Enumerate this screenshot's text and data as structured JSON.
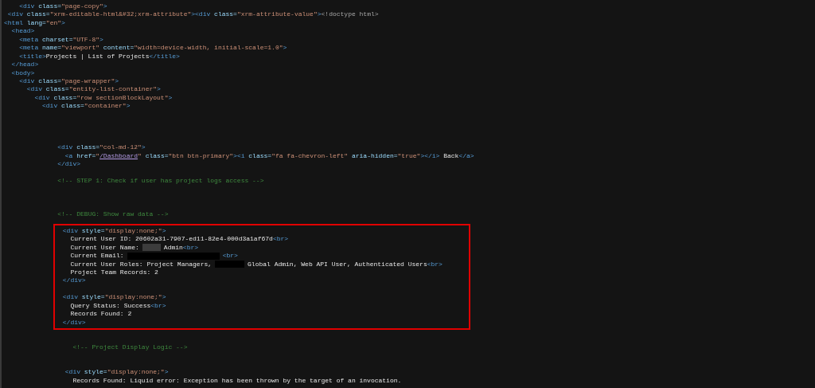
{
  "lines": [
    {
      "kind": "code",
      "tokens": [
        {
          "kind": "tag",
          "text": "    <div"
        },
        {
          "kind": "attr",
          "text": " class="
        },
        {
          "kind": "value",
          "text": "\"page-copy\""
        },
        {
          "kind": "tag",
          "text": ">"
        }
      ]
    },
    {
      "kind": "code",
      "tokens": [
        {
          "kind": "tag",
          "text": " <div"
        },
        {
          "kind": "attr",
          "text": " class="
        },
        {
          "kind": "value",
          "text": "\"xrm-editable-html&#32;xrm-attribute\""
        },
        {
          "kind": "tag",
          "text": "><div"
        },
        {
          "kind": "attr",
          "text": " class="
        },
        {
          "kind": "value",
          "text": "\"xrm-attribute-value\""
        },
        {
          "kind": "tag",
          "text": ">"
        },
        {
          "kind": "doctype",
          "text": "<!doctype html>"
        }
      ]
    },
    {
      "kind": "code",
      "tokens": [
        {
          "kind": "tag",
          "text": "<html"
        },
        {
          "kind": "attr",
          "text": " lang="
        },
        {
          "kind": "value",
          "text": "\"en\""
        },
        {
          "kind": "tag",
          "text": ">"
        }
      ]
    },
    {
      "kind": "code",
      "tokens": [
        {
          "kind": "tag",
          "text": "  <head>"
        }
      ]
    },
    {
      "kind": "code",
      "tokens": [
        {
          "kind": "tag",
          "text": "    <meta"
        },
        {
          "kind": "attr",
          "text": " charset="
        },
        {
          "kind": "value",
          "text": "\"UTF-8\""
        },
        {
          "kind": "tag",
          "text": ">"
        }
      ]
    },
    {
      "kind": "code",
      "tokens": [
        {
          "kind": "tag",
          "text": "    <meta"
        },
        {
          "kind": "attr",
          "text": " name="
        },
        {
          "kind": "value",
          "text": "\"viewport\""
        },
        {
          "kind": "attr",
          "text": " content="
        },
        {
          "kind": "value",
          "text": "\"width=device-width, initial-scale=1.0\""
        },
        {
          "kind": "tag",
          "text": ">"
        }
      ]
    },
    {
      "kind": "code",
      "tokens": [
        {
          "kind": "tag",
          "text": "    <title>"
        },
        {
          "kind": "text",
          "text": "Projects | List of Projects"
        },
        {
          "kind": "tag",
          "text": "</title>"
        }
      ]
    },
    {
      "kind": "code",
      "tokens": [
        {
          "kind": "tag",
          "text": "  </head>"
        }
      ]
    },
    {
      "kind": "code",
      "tokens": [
        {
          "kind": "tag",
          "text": "  <body>"
        }
      ]
    },
    {
      "kind": "code",
      "tokens": [
        {
          "kind": "tag",
          "text": "    <div"
        },
        {
          "kind": "attr",
          "text": " class="
        },
        {
          "kind": "value",
          "text": "\"page-wrapper\""
        },
        {
          "kind": "tag",
          "text": ">"
        }
      ]
    },
    {
      "kind": "code",
      "tokens": [
        {
          "kind": "tag",
          "text": "      <div"
        },
        {
          "kind": "attr",
          "text": " class="
        },
        {
          "kind": "value",
          "text": "\"entity-list-container\""
        },
        {
          "kind": "tag",
          "text": ">"
        }
      ]
    },
    {
      "kind": "code",
      "tokens": [
        {
          "kind": "tag",
          "text": "        <div"
        },
        {
          "kind": "attr",
          "text": " class="
        },
        {
          "kind": "value",
          "text": "\"row sectionBlockLayout\""
        },
        {
          "kind": "tag",
          "text": ">"
        }
      ]
    },
    {
      "kind": "code",
      "tokens": [
        {
          "kind": "tag",
          "text": "          <div"
        },
        {
          "kind": "attr",
          "text": " class="
        },
        {
          "kind": "value",
          "text": "\"container\""
        },
        {
          "kind": "tag",
          "text": ">"
        }
      ]
    },
    {
      "kind": "blank"
    },
    {
      "kind": "blank"
    },
    {
      "kind": "blank"
    },
    {
      "kind": "blank"
    },
    {
      "kind": "code",
      "tokens": [
        {
          "kind": "tag",
          "text": "              <div"
        },
        {
          "kind": "attr",
          "text": " class="
        },
        {
          "kind": "value",
          "text": "\"col-md-12\""
        },
        {
          "kind": "tag",
          "text": ">"
        }
      ]
    },
    {
      "kind": "code",
      "tokens": [
        {
          "kind": "tag",
          "text": "                <a"
        },
        {
          "kind": "attr",
          "text": " href="
        },
        {
          "kind": "value",
          "text": "\""
        },
        {
          "kind": "link",
          "text": "/Dashboard"
        },
        {
          "kind": "value",
          "text": "\""
        },
        {
          "kind": "attr",
          "text": " class="
        },
        {
          "kind": "value",
          "text": "\"btn btn-primary\""
        },
        {
          "kind": "tag",
          "text": "><i"
        },
        {
          "kind": "attr",
          "text": " class="
        },
        {
          "kind": "value",
          "text": "\"fa fa-chevron-left\""
        },
        {
          "kind": "attr",
          "text": " aria-hidden="
        },
        {
          "kind": "value",
          "text": "\"true\""
        },
        {
          "kind": "tag",
          "text": "></i>"
        },
        {
          "kind": "text",
          "text": " Back"
        },
        {
          "kind": "tag",
          "text": "</a>"
        }
      ]
    },
    {
      "kind": "code",
      "tokens": [
        {
          "kind": "tag",
          "text": "              </div>"
        }
      ]
    },
    {
      "kind": "blank"
    },
    {
      "kind": "code",
      "tokens": [
        {
          "kind": "comment",
          "text": "              <!-- STEP 1: Check if user has project logs access -->"
        }
      ]
    },
    {
      "kind": "blank"
    },
    {
      "kind": "blank"
    },
    {
      "kind": "blank"
    },
    {
      "kind": "code",
      "tokens": [
        {
          "kind": "comment",
          "text": "              <!-- DEBUG: Show raw data -->"
        }
      ]
    },
    {
      "kind": "blank"
    },
    {
      "kind": "code",
      "highlighted": true,
      "tokens": [
        {
          "kind": "tag",
          "text": "                <div"
        },
        {
          "kind": "attr",
          "text": " style="
        },
        {
          "kind": "value",
          "text": "\"display:none;\""
        },
        {
          "kind": "tag",
          "text": ">"
        }
      ]
    },
    {
      "kind": "code",
      "highlighted": true,
      "tokens": [
        {
          "kind": "text",
          "text": "                  Current User ID: 20602a31-7907-ed11-82e4-000d3a1af67d"
        },
        {
          "kind": "tag",
          "text": "<br>"
        }
      ]
    },
    {
      "kind": "code",
      "highlighted": true,
      "tokens": [
        {
          "kind": "text",
          "text": "                  Current User Name:"
        },
        {
          "kind": "smudge"
        },
        {
          "kind": "text",
          "text": "Admin"
        },
        {
          "kind": "tag",
          "text": "<br>"
        }
      ]
    },
    {
      "kind": "code",
      "highlighted": true,
      "tokens": [
        {
          "kind": "text",
          "text": "                  Current Email:"
        },
        {
          "kind": "bar"
        },
        {
          "kind": "tag",
          "text": "<br>"
        }
      ]
    },
    {
      "kind": "code",
      "highlighted": true,
      "tokens": [
        {
          "kind": "text",
          "text": "                  Current User Roles: Project Managers,"
        },
        {
          "kind": "mask"
        },
        {
          "kind": "text",
          "text": "Global Admin, Web API User, Authenticated Users"
        },
        {
          "kind": "tag",
          "text": "<br>"
        }
      ]
    },
    {
      "kind": "code",
      "highlighted": true,
      "tokens": [
        {
          "kind": "text",
          "text": "                  Project Team Records: 2"
        }
      ]
    },
    {
      "kind": "code",
      "highlighted": true,
      "tokens": [
        {
          "kind": "tag",
          "text": "                </div>"
        }
      ]
    },
    {
      "kind": "blank",
      "highlighted": true
    },
    {
      "kind": "code",
      "highlighted": true,
      "tokens": [
        {
          "kind": "tag",
          "text": "                <div"
        },
        {
          "kind": "attr",
          "text": " style="
        },
        {
          "kind": "value",
          "text": "\"display:none;\""
        },
        {
          "kind": "tag",
          "text": ">"
        }
      ]
    },
    {
      "kind": "code",
      "highlighted": true,
      "tokens": [
        {
          "kind": "text",
          "text": "                  Query Status: Success"
        },
        {
          "kind": "tag",
          "text": "<br>"
        }
      ]
    },
    {
      "kind": "code",
      "highlighted": true,
      "tokens": [
        {
          "kind": "text",
          "text": "                  Records Found: 2"
        }
      ]
    },
    {
      "kind": "code",
      "highlighted": true,
      "tokens": [
        {
          "kind": "tag",
          "text": "                </div>"
        }
      ]
    },
    {
      "kind": "blank"
    },
    {
      "kind": "blank"
    },
    {
      "kind": "code",
      "tokens": [
        {
          "kind": "comment",
          "text": "                  <!-- Project Display Logic -->"
        }
      ]
    },
    {
      "kind": "blank"
    },
    {
      "kind": "blank"
    },
    {
      "kind": "code",
      "tokens": [
        {
          "kind": "tag",
          "text": "                <div"
        },
        {
          "kind": "attr",
          "text": " style="
        },
        {
          "kind": "value",
          "text": "\"display:none;\""
        },
        {
          "kind": "tag",
          "text": ">"
        }
      ]
    },
    {
      "kind": "code",
      "tokens": [
        {
          "kind": "text",
          "text": "                  Records Found: Liquid error: Exception has been thrown by the target of an invocation."
        }
      ]
    }
  ]
}
